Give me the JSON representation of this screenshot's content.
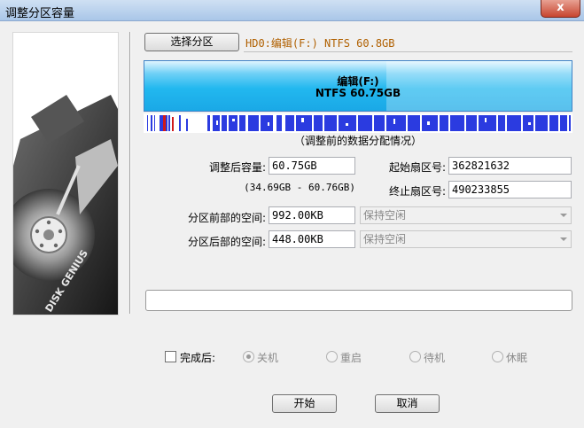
{
  "window": {
    "title": "调整分区容量",
    "close_glyph": "x"
  },
  "banner": {
    "brand_text": "DISK GENIUS"
  },
  "toolbar": {
    "select_partition_label": "选择分区"
  },
  "disk": {
    "info": "HD0:编辑(F:) NTFS 60.8GB"
  },
  "partition": {
    "name": "编辑(F:)",
    "fs_size": "NTFS 60.75GB"
  },
  "map": {
    "caption": "（调整前的数据分配情况）"
  },
  "form": {
    "size_label": "调整后容量:",
    "size_value": "60.75GB",
    "size_range": "(34.69GB - 60.76GB)",
    "start_sector_label": "起始扇区号:",
    "start_sector_value": "362821632",
    "end_sector_label": "终止扇区号:",
    "end_sector_value": "490233855",
    "before_space_label": "分区前部的空间:",
    "before_space_value": "992.00KB",
    "before_space_mode": "保持空闲",
    "after_space_label": "分区后部的空间:",
    "after_space_value": "448.00KB",
    "after_space_mode": "保持空闲"
  },
  "progress": {
    "value": 0
  },
  "completion": {
    "label": "完成后:",
    "options": [
      "关机",
      "重启",
      "待机",
      "休眠"
    ]
  },
  "buttons": {
    "start": "开始",
    "cancel": "取消"
  }
}
